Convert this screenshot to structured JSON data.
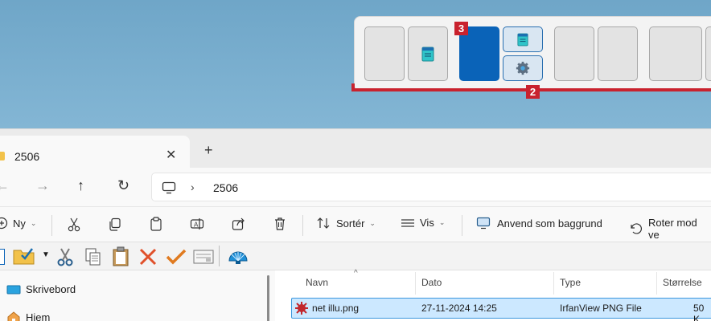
{
  "snap_layout": {
    "badge_area": "3",
    "badge_bar": "2"
  },
  "tab": {
    "title": "2506",
    "close": "✕",
    "new_tab": "+"
  },
  "nav": {
    "back": "←",
    "forward": "→",
    "up": "↑",
    "refresh": "↻",
    "chevron": "›",
    "path": "2506"
  },
  "commands": {
    "new": "Ny",
    "sort": "Sortér",
    "view": "Vis",
    "set_background": "Anvend som baggrund",
    "rotate": "Roter mod ve"
  },
  "sidebar": {
    "items": [
      {
        "label": "Skrivebord",
        "icon": "desktop-icon"
      },
      {
        "label": "Hjem",
        "icon": "home-icon"
      }
    ]
  },
  "files": {
    "columns": [
      "Navn",
      "Dato",
      "Type",
      "Størrelse"
    ],
    "rows": [
      {
        "name": "net illu.png",
        "date": "27-11-2024 14:25",
        "type": "IrfanView PNG File",
        "size": "50 K"
      }
    ]
  },
  "colors": {
    "accent": "#0a63b8",
    "callout_red": "#c9222e",
    "selection": "#cce8ff"
  }
}
